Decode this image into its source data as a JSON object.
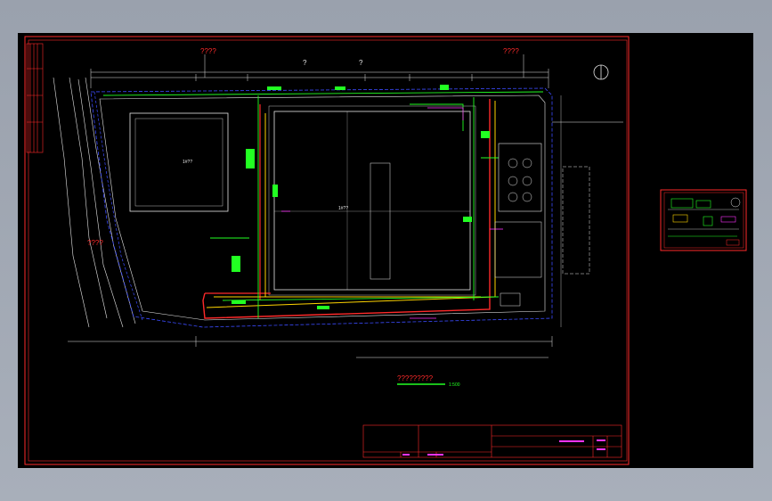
{
  "drawing": {
    "title_top_left": "????",
    "title_top_right": "????",
    "mark_q1": "?",
    "mark_q2": "?",
    "left_road_label": "????",
    "legend_title": "?????????",
    "legend_scale": "1:500",
    "north_symbol": "north-arrow-icon",
    "building_left_label": "1#??",
    "building_main_label": "1#??"
  },
  "colors": {
    "background": "#000000",
    "frame_red": "#ff2a2a",
    "pipe_green": "#22ff22",
    "pipe_blue": "#3b4bff",
    "pipe_magenta": "#ff33ff",
    "dim_white": "#e6e6e6",
    "accent_yellow": "#ffd400"
  }
}
